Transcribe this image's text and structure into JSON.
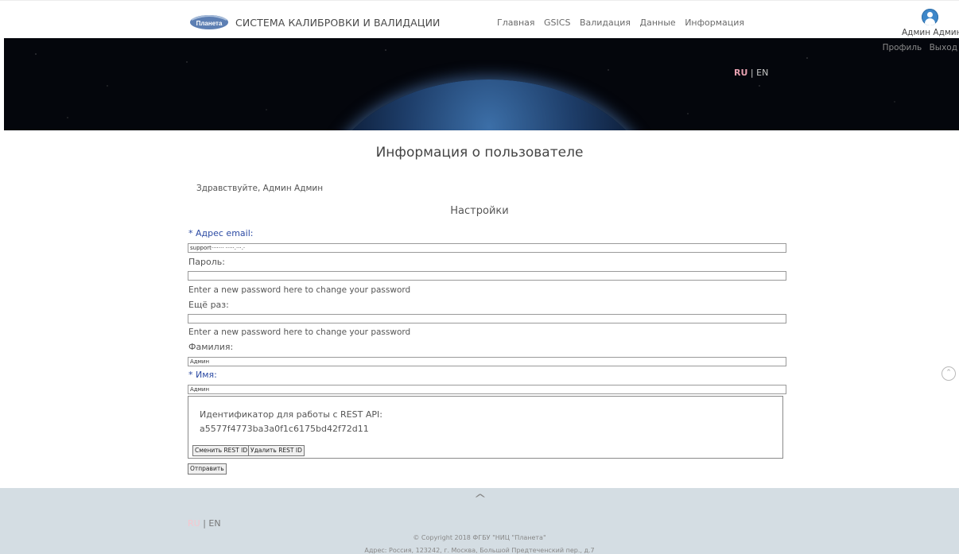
{
  "header": {
    "logo_text": "Планета",
    "title": "СИСТЕМА КАЛИБРОВКИ И ВАЛИДАЦИИ",
    "nav": [
      "Главная",
      "GSICS",
      "Валидация",
      "Данные",
      "Информация"
    ],
    "user_name": "Админ Админ",
    "user_links": [
      "Профиль",
      "Выход"
    ]
  },
  "banner": {
    "lang_active": "RU",
    "lang_separator": "|",
    "lang_other": "EN"
  },
  "main": {
    "page_title": "Информация о пользователе",
    "greeting": "Здравствуйте, Админ Админ",
    "section_title": "Настройки",
    "email_label": "* Адрес email:",
    "email_value": "support·······   ·····.···.·",
    "password_label": "Пароль:",
    "password_value": "",
    "password_hint": "Enter a new password here to change your password",
    "password2_label": "Ещё раз:",
    "password2_value": "",
    "password2_hint": "Enter a new password here to change your password",
    "lastname_label": "Фамилия:",
    "lastname_value": "Админ",
    "firstname_label": "* Имя:",
    "firstname_value": "Админ",
    "api_label": "Идентификатор для работы с REST API:",
    "api_key": "a5577f4773ba3a0f1c6175bd42f72d11",
    "change_api_button": "Сменить REST ID",
    "delete_api_button": "Удалить REST ID",
    "submit_button": "Отправить"
  },
  "footer": {
    "up_arrow": "^",
    "lang_active": "RU",
    "lang_separator": "|",
    "lang_other": "EN",
    "copyright": "© Copyright 2018 ФГБУ \"НИЦ \"Планета\"",
    "address": "Адрес: Россия, 123242, г. Москва, Большой Предтеченский пер., д.7"
  },
  "colors": {
    "required_label": "#2b4aa3",
    "footer_bg": "#d4dde3",
    "lang_active": "#e7a0b0"
  }
}
